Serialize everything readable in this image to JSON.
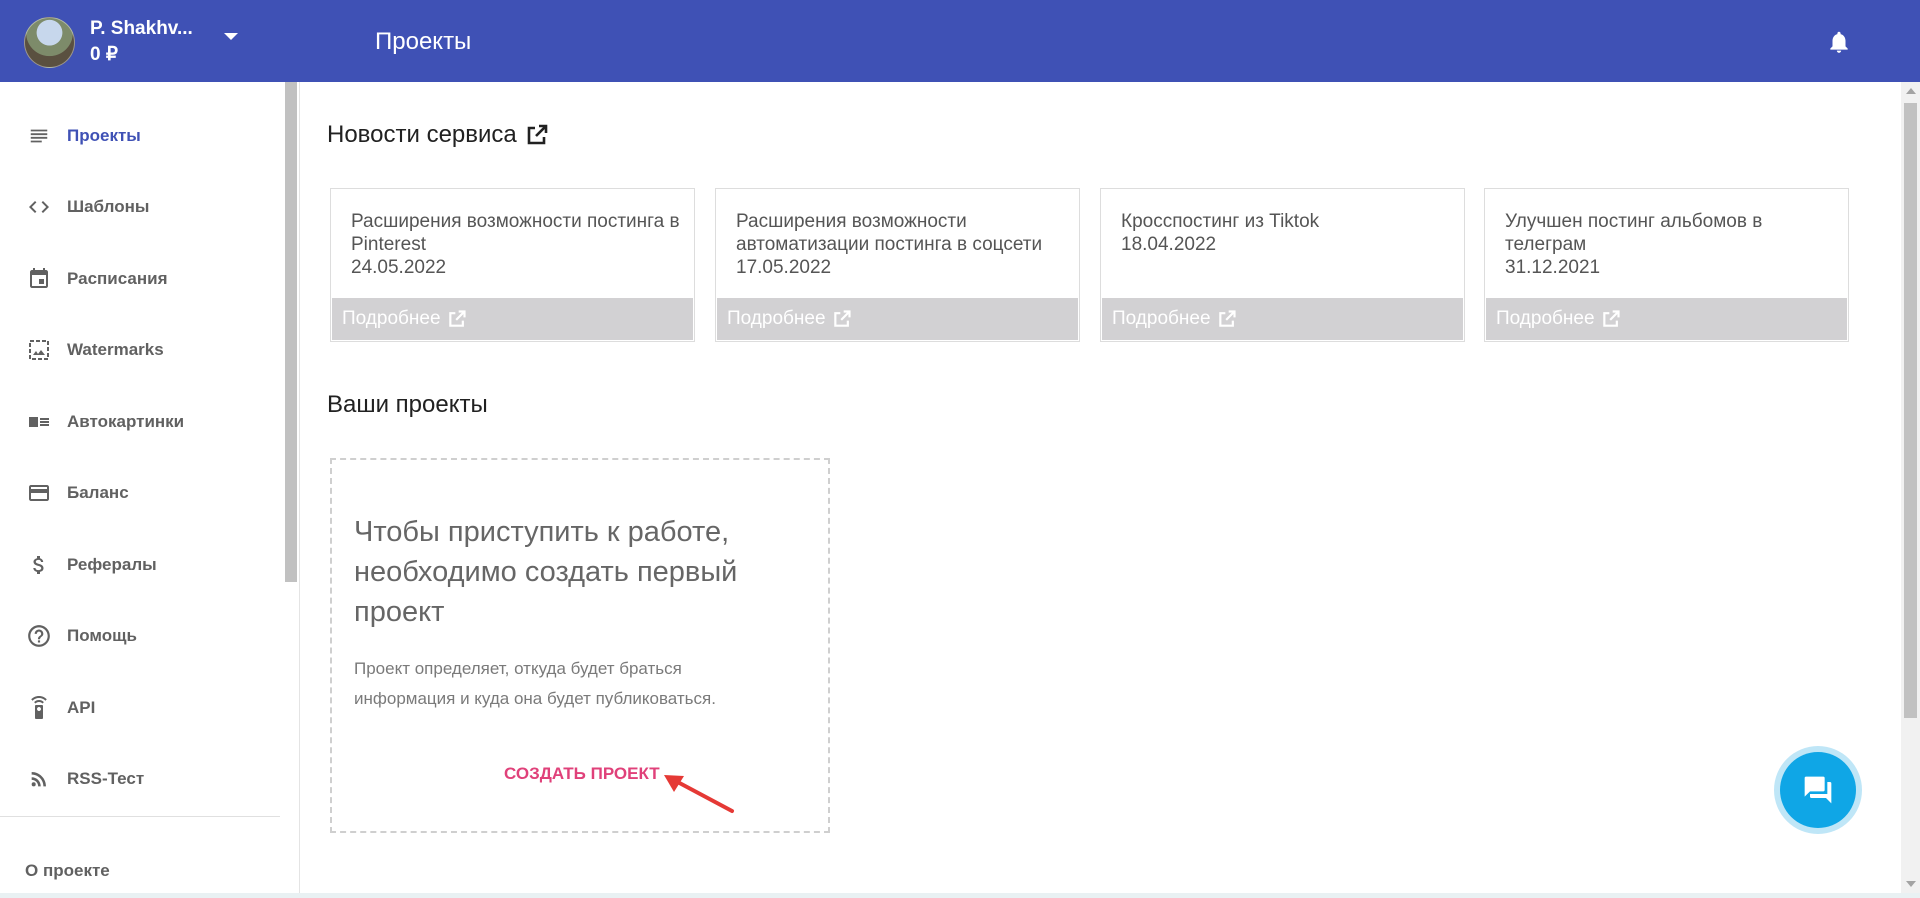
{
  "header": {
    "user_name": "P. Shakhv...",
    "balance": "0 ₽",
    "page_title": "Проекты"
  },
  "sidebar": {
    "items": [
      {
        "label": "Проекты",
        "icon": "list-lines-icon",
        "active": true
      },
      {
        "label": "Шаблоны",
        "icon": "code-brackets-icon"
      },
      {
        "label": "Расписания",
        "icon": "calendar-icon"
      },
      {
        "label": "Watermarks",
        "icon": "image-frame-icon"
      },
      {
        "label": "Автокартинки",
        "icon": "image-list-icon"
      },
      {
        "label": "Баланс",
        "icon": "credit-card-icon"
      },
      {
        "label": "Рефералы",
        "icon": "dollar-icon"
      },
      {
        "label": "Помощь",
        "icon": "help-circle-icon"
      },
      {
        "label": "API",
        "icon": "remote-icon"
      },
      {
        "label": "RSS-Тест",
        "icon": "rss-icon"
      }
    ],
    "about": "О проекте"
  },
  "news": {
    "title": "Новости сервиса",
    "cards": [
      {
        "text": "Расширения возможности постинга в Pinterest",
        "date": "24.05.2022",
        "more": "Подробнее"
      },
      {
        "text": "Расширения возможности автоматизации постинга в соцсети",
        "date": "17.05.2022",
        "more": "Подробнее"
      },
      {
        "text": "Кросспостинг из Tiktok",
        "date": "18.04.2022",
        "more": "Подробнее"
      },
      {
        "text": "Улучшен постинг альбомов в телеграм",
        "date": "31.12.2021",
        "more": "Подробнее"
      }
    ]
  },
  "projects": {
    "title": "Ваши проекты",
    "empty_title": "Чтобы приступить к работе, необходимо создать первый проект",
    "empty_desc": "Проект определяет, откуда будет браться информация и куда она будет публиковаться.",
    "create_label": "СОЗДАТЬ ПРОЕКТ"
  },
  "colors": {
    "header": "#3f51b5",
    "accent_pink": "#e0417a",
    "chat": "#0fa6e6",
    "annotation_arrow": "#e53935"
  }
}
